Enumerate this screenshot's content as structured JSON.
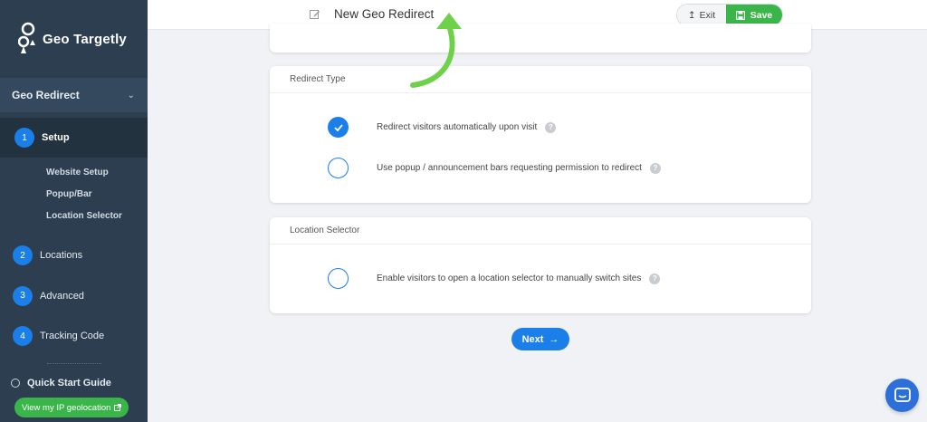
{
  "app": {
    "name": "Geo Targetly"
  },
  "header": {
    "title": "New Geo Redirect",
    "exit_label": "Exit",
    "save_label": "Save"
  },
  "sidebar": {
    "section_label": "Geo Redirect",
    "steps": [
      {
        "num": "1",
        "label": "Setup",
        "sub": [
          "Website Setup",
          "Popup/Bar",
          "Location Selector"
        ]
      },
      {
        "num": "2",
        "label": "Locations"
      },
      {
        "num": "3",
        "label": "Advanced"
      },
      {
        "num": "4",
        "label": "Tracking Code"
      }
    ],
    "quick_start": "Quick Start Guide",
    "geo_button": "View my IP geolocation"
  },
  "redirect_type": {
    "title": "Redirect Type",
    "options": [
      {
        "label": "Redirect visitors automatically upon visit",
        "checked": true
      },
      {
        "label": "Use popup / announcement bars requesting permission to redirect",
        "checked": false
      }
    ]
  },
  "location_selector": {
    "title": "Location Selector",
    "options": [
      {
        "label": "Enable visitors to open a location selector to manually switch sites",
        "checked": false
      }
    ]
  },
  "next_label": "Next",
  "help_glyph": "?",
  "colors": {
    "sidebar": "#2c3e50",
    "accent_blue": "#1a7fe8",
    "accent_green": "#3ab54a"
  }
}
